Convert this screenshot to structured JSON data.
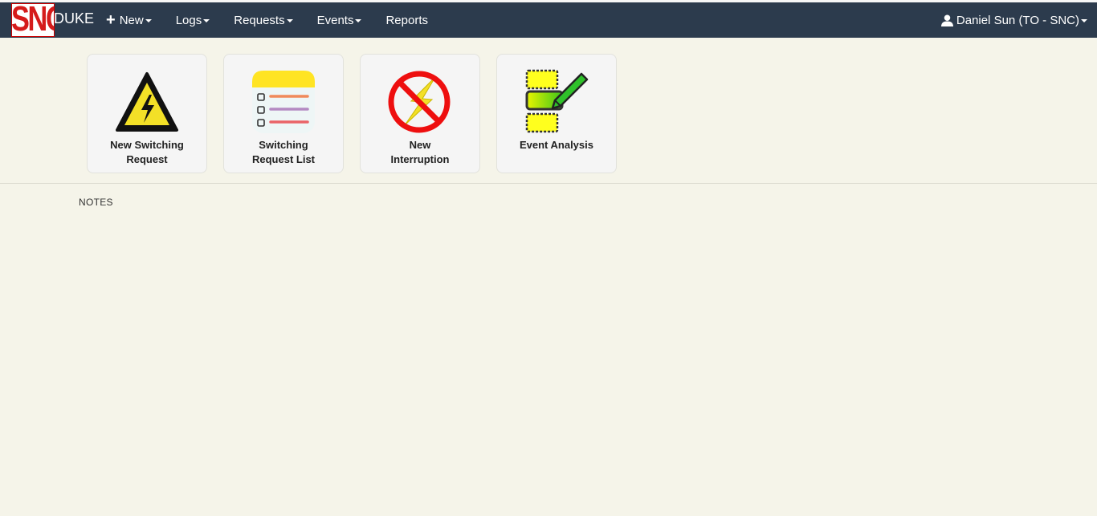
{
  "brand": {
    "logo_text": "SNC",
    "name": "DUKE"
  },
  "nav": {
    "items": [
      {
        "label": "New",
        "has_plus": true,
        "has_caret": true
      },
      {
        "label": "Logs",
        "has_caret": true
      },
      {
        "label": "Requests",
        "has_caret": true
      },
      {
        "label": "Events",
        "has_caret": true
      },
      {
        "label": "Reports",
        "has_caret": false
      }
    ],
    "user": "Daniel Sun (TO - SNC)"
  },
  "tiles": [
    {
      "line1": "New Switching",
      "line2": "Request",
      "icon": "high-voltage-warning-icon"
    },
    {
      "line1": "Switching",
      "line2": "Request List",
      "icon": "checklist-notepad-icon"
    },
    {
      "line1": "New",
      "line2": "Interruption",
      "icon": "no-power-icon"
    },
    {
      "line1": "Event Analysis",
      "line2": "",
      "icon": "edit-document-icon"
    }
  ],
  "notes_label": "NOTES",
  "colors": {
    "navbar": "#2c3b4d",
    "background": "#f5f4e9",
    "logo_red": "#d51b1b"
  }
}
